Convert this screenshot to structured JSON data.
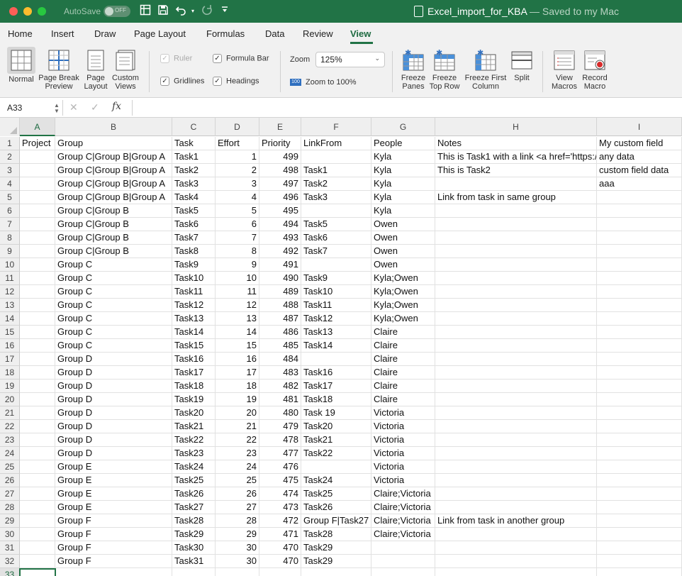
{
  "titlebar": {
    "autosave_label": "AutoSave",
    "autosave_state": "OFF",
    "file_name": "Excel_import_for_KBA",
    "saved_status": " — Saved to my Mac"
  },
  "tabs": [
    "Home",
    "Insert",
    "Draw",
    "Page Layout",
    "Formulas",
    "Data",
    "Review",
    "View"
  ],
  "active_tab": "View",
  "ribbon": {
    "normal": "Normal",
    "page_break_1": "Page Break",
    "page_break_2": "Preview",
    "page_layout_1": "Page",
    "page_layout_2": "Layout",
    "custom_views_1": "Custom",
    "custom_views_2": "Views",
    "ruler": "Ruler",
    "gridlines": "Gridlines",
    "formula_bar": "Formula Bar",
    "headings": "Headings",
    "zoom_label": "Zoom",
    "zoom_value": "125%",
    "zoom_100": "Zoom to 100%",
    "freeze_panes_1": "Freeze",
    "freeze_panes_2": "Panes",
    "freeze_top_1": "Freeze",
    "freeze_top_2": "Top Row",
    "freeze_first_1": "Freeze First",
    "freeze_first_2": "Column",
    "split": "Split",
    "view_macros_1": "View",
    "view_macros_2": "Macros",
    "record_macro_1": "Record",
    "record_macro_2": "Macro",
    "checkbox_states": {
      "ruler": true,
      "gridlines": true,
      "formula_bar": true,
      "headings": true
    },
    "ruler_disabled": true
  },
  "formula_bar": {
    "name_box": "A33",
    "formula": ""
  },
  "grid": {
    "columns": [
      "A",
      "B",
      "C",
      "D",
      "E",
      "F",
      "G",
      "H",
      "I"
    ],
    "selected_column": "A",
    "selected_row": "33",
    "row_numbers": [
      "1",
      "2",
      "3",
      "4",
      "5",
      "6",
      "7",
      "8",
      "9",
      "10",
      "11",
      "12",
      "13",
      "14",
      "15",
      "16",
      "17",
      "18",
      "19",
      "20",
      "21",
      "22",
      "23",
      "24",
      "25",
      "26",
      "27",
      "28",
      "29",
      "30",
      "31",
      "32",
      "33"
    ],
    "rows": [
      [
        "Project",
        "Group",
        "Task",
        "Effort",
        "Priority",
        "LinkFrom",
        "People",
        "Notes",
        "My custom field"
      ],
      [
        "",
        "Group C|Group B|Group A",
        "Task1",
        "1",
        "499",
        "",
        "Kyla",
        "This is Task1 with a link <a href='https://",
        "any data"
      ],
      [
        "",
        "Group C|Group B|Group A",
        "Task2",
        "2",
        "498",
        "Task1",
        "Kyla",
        "This is Task2",
        "custom field data"
      ],
      [
        "",
        "Group C|Group B|Group A",
        "Task3",
        "3",
        "497",
        "Task2",
        "Kyla",
        "",
        "aaa"
      ],
      [
        "",
        "Group C|Group B|Group A",
        "Task4",
        "4",
        "496",
        "Task3",
        "Kyla",
        "Link from task in same group",
        ""
      ],
      [
        "",
        "Group C|Group B",
        "Task5",
        "5",
        "495",
        "",
        "Kyla",
        "",
        ""
      ],
      [
        "",
        "Group C|Group B",
        "Task6",
        "6",
        "494",
        "Task5",
        "Owen",
        "",
        ""
      ],
      [
        "",
        "Group C|Group B",
        "Task7",
        "7",
        "493",
        "Task6",
        "Owen",
        "",
        ""
      ],
      [
        "",
        "Group C|Group B",
        "Task8",
        "8",
        "492",
        "Task7",
        "Owen",
        "",
        ""
      ],
      [
        "",
        "Group C",
        "Task9",
        "9",
        "491",
        "",
        "Owen",
        "",
        ""
      ],
      [
        "",
        "Group C",
        "Task10",
        "10",
        "490",
        "Task9",
        "Kyla;Owen",
        "",
        ""
      ],
      [
        "",
        "Group C",
        "Task11",
        "11",
        "489",
        "Task10",
        "Kyla;Owen",
        "",
        ""
      ],
      [
        "",
        "Group C",
        "Task12",
        "12",
        "488",
        "Task11",
        "Kyla;Owen",
        "",
        ""
      ],
      [
        "",
        "Group C",
        "Task13",
        "13",
        "487",
        "Task12",
        "Kyla;Owen",
        "",
        ""
      ],
      [
        "",
        "Group C",
        "Task14",
        "14",
        "486",
        "Task13",
        "Claire",
        "",
        ""
      ],
      [
        "",
        "Group C",
        "Task15",
        "15",
        "485",
        "Task14",
        "Claire",
        "",
        ""
      ],
      [
        "",
        "Group D",
        "Task16",
        "16",
        "484",
        "",
        "Claire",
        "",
        ""
      ],
      [
        "",
        "Group D",
        "Task17",
        "17",
        "483",
        "Task16",
        "Claire",
        "",
        ""
      ],
      [
        "",
        "Group D",
        "Task18",
        "18",
        "482",
        "Task17",
        "Claire",
        "",
        ""
      ],
      [
        "",
        "Group D",
        "Task19",
        "19",
        "481",
        "Task18",
        "Claire",
        "",
        ""
      ],
      [
        "",
        "Group D",
        "Task20",
        "20",
        "480",
        "Task 19",
        "Victoria",
        "",
        ""
      ],
      [
        "",
        "Group D",
        "Task21",
        "21",
        "479",
        "Task20",
        "Victoria",
        "",
        ""
      ],
      [
        "",
        "Group D",
        "Task22",
        "22",
        "478",
        "Task21",
        "Victoria",
        "",
        ""
      ],
      [
        "",
        "Group D",
        "Task23",
        "23",
        "477",
        "Task22",
        "Victoria",
        "",
        ""
      ],
      [
        "",
        "Group E",
        "Task24",
        "24",
        "476",
        "",
        "Victoria",
        "",
        ""
      ],
      [
        "",
        "Group E",
        "Task25",
        "25",
        "475",
        "Task24",
        "Victoria",
        "",
        ""
      ],
      [
        "",
        "Group E",
        "Task26",
        "26",
        "474",
        "Task25",
        "Claire;Victoria",
        "",
        ""
      ],
      [
        "",
        "Group E",
        "Task27",
        "27",
        "473",
        "Task26",
        "Claire;Victoria",
        "",
        ""
      ],
      [
        "",
        "Group F",
        "Task28",
        "28",
        "472",
        "Group F|Task27",
        "Claire;Victoria",
        "Link from task in another group",
        ""
      ],
      [
        "",
        "Group F",
        "Task29",
        "29",
        "471",
        "Task28",
        "Claire;Victoria",
        "",
        ""
      ],
      [
        "",
        "Group F",
        "Task30",
        "30",
        "470",
        "Task29",
        "",
        "",
        ""
      ],
      [
        "",
        "Group F",
        "Task31",
        "30",
        "470",
        "Task29",
        "",
        "",
        ""
      ],
      [
        "",
        "",
        "",
        "",
        "",
        "",
        "",
        "",
        ""
      ]
    ]
  },
  "colors": {
    "excel_green": "#217346",
    "active_green": "#1d6a40"
  }
}
